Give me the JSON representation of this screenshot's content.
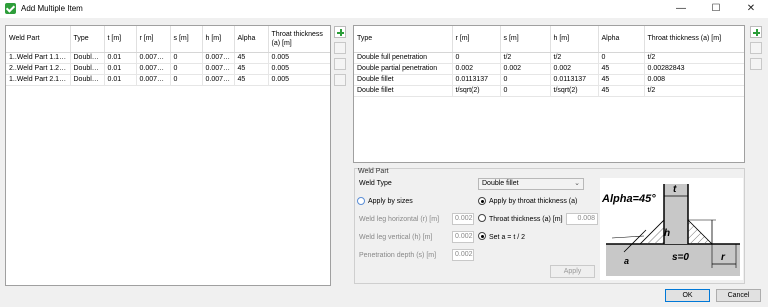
{
  "window": {
    "title": "Add Multiple Item"
  },
  "left_table": {
    "columns": [
      "Weld Part",
      "Type",
      "t [m]",
      "r [m]",
      "s [m]",
      "h [m]",
      "Alpha",
      "Throat thickness (a) [m]"
    ],
    "rows": [
      [
        "1..Weld Part 1.1 [1.1]",
        "Double fi",
        "0.01",
        "0.007071",
        "0",
        "0.007071",
        "45",
        "0.005"
      ],
      [
        "2..Weld Part 1.2 [1.1]",
        "Double fi",
        "0.01",
        "0.007071",
        "0",
        "0.007071",
        "45",
        "0.005"
      ],
      [
        "1..Weld Part 2.1 [-1...",
        "Double fi",
        "0.01",
        "0.007071",
        "0",
        "0.007071",
        "45",
        "0.005"
      ]
    ]
  },
  "right_table": {
    "columns": [
      "Type",
      "r [m]",
      "s [m]",
      "h [m]",
      "Alpha",
      "Throat thickness (a) [m]"
    ],
    "rows": [
      [
        "Double full penetration",
        "0",
        "t/2",
        "t/2",
        "0",
        "t/2"
      ],
      [
        "Double partial penetration",
        "0.002",
        "0.002",
        "0.002",
        "45",
        "0.00282843"
      ],
      [
        "Double fillet",
        "0.0113137",
        "0",
        "0.0113137",
        "45",
        "0.008"
      ],
      [
        "Double fillet",
        "t/sqrt(2)",
        "0",
        "t/sqrt(2)",
        "45",
        "t/2"
      ]
    ]
  },
  "weld_part": {
    "group_title": "Weld Part",
    "weld_type_label": "Weld Type",
    "weld_type_value": "Double fillet",
    "apply_by_sizes": "Apply by sizes",
    "apply_by_throat": "Apply by throat thickness (a)",
    "leg_horizontal_label": "Weld leg horizontal (r) [m]",
    "leg_horizontal_value": "0.002",
    "leg_vertical_label": "Weld leg vertical (h) [m]",
    "leg_vertical_value": "0.002",
    "penetration_label": "Penetration depth (s) [m]",
    "penetration_value": "0.002",
    "throat_label": "Throat thickness (a) [m]",
    "throat_value": "0.008",
    "set_a_label": "Set a = t / 2",
    "apply_button": "Apply"
  },
  "diagram": {
    "alpha": "Alpha=45°",
    "t": "t",
    "h": "h",
    "s": "s=0",
    "r": "r",
    "a": "a"
  },
  "footer": {
    "ok": "OK",
    "cancel": "Cancel"
  },
  "colors": {
    "accent_green": "#2a9d38",
    "focus_blue": "#0078d7"
  }
}
